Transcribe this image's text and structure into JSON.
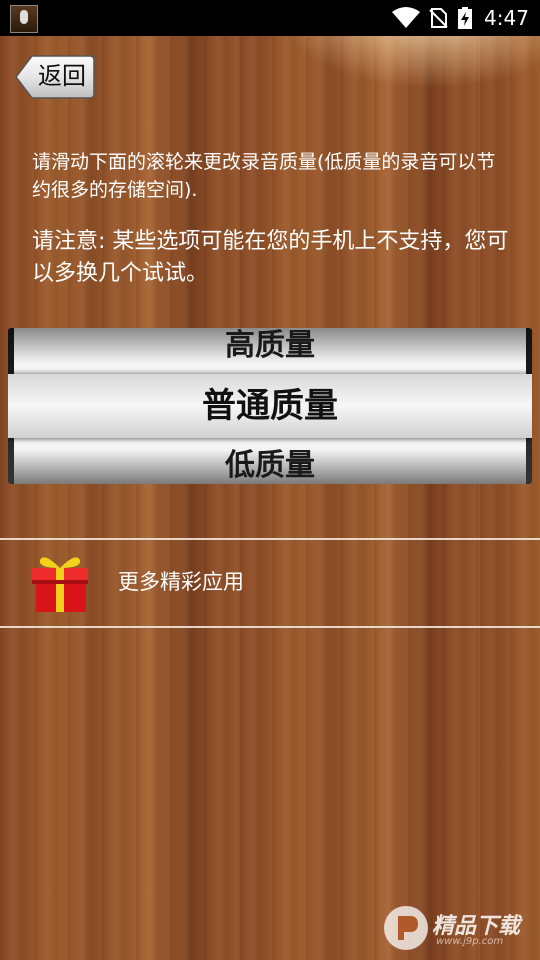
{
  "status_bar": {
    "time": "4:47",
    "icons": [
      "app-icon",
      "wifi-icon",
      "no-sim-icon",
      "battery-charging-icon"
    ]
  },
  "header": {
    "back_label": "返回"
  },
  "content": {
    "instructions": "请滑动下面的滚轮来更改录音质量(低质量的录音可以节约很多的存储空间).",
    "note": "请注意: 某些选项可能在您的手机上不支持，您可以多换几个试试。"
  },
  "picker": {
    "options": [
      "高质量",
      "普通质量",
      "低质量"
    ],
    "selected": "普通质量"
  },
  "more_apps": {
    "label": "更多精彩应用",
    "icon": "gift-icon"
  },
  "watermark": {
    "text": "精品下载",
    "url": "www.j9p.com"
  }
}
